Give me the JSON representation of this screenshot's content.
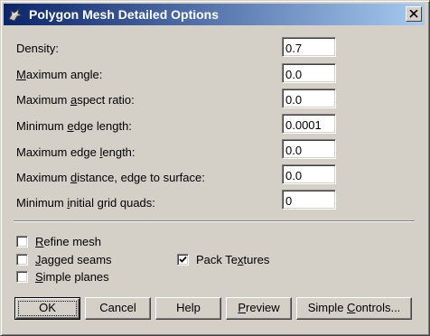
{
  "window": {
    "title": "Polygon Mesh Detailed Options"
  },
  "fields": [
    {
      "pre": "Density:",
      "u": "",
      "post": "",
      "value": "0.7"
    },
    {
      "pre": "",
      "u": "M",
      "post": "aximum angle:",
      "value": "0.0"
    },
    {
      "pre": "Maximum ",
      "u": "a",
      "post": "spect ratio:",
      "value": "0.0"
    },
    {
      "pre": "Minimum ",
      "u": "e",
      "post": "dge length:",
      "value": "0.0001"
    },
    {
      "pre": "Maximum edge ",
      "u": "l",
      "post": "ength:",
      "value": "0.0"
    },
    {
      "pre": "Maximum ",
      "u": "d",
      "post": "istance, edge to surface:",
      "value": "0.0"
    },
    {
      "pre": "Minimum ",
      "u": "i",
      "post": "nitial grid quads:",
      "value": "0"
    }
  ],
  "checkboxes": {
    "refine": {
      "u": "R",
      "post": "efine mesh",
      "checked": false
    },
    "jagged": {
      "u": "J",
      "post": "agged seams",
      "checked": false
    },
    "simple": {
      "u": "S",
      "post": "imple planes",
      "checked": false
    },
    "pack": {
      "pre": "Pack Te",
      "u": "x",
      "post": "tures",
      "checked": true
    }
  },
  "buttons": {
    "ok": "OK",
    "cancel": "Cancel",
    "help": "Help",
    "preview_u": "P",
    "preview_post": "review",
    "simple_pre": "Simple ",
    "simple_u": "C",
    "simple_post": "ontrols..."
  },
  "icons": {
    "app": "rhino-icon",
    "close": "close-icon",
    "check": "check-icon"
  },
  "colors": {
    "face": "#d4d0c8",
    "title_start": "#0a246a",
    "title_end": "#a6caf0"
  }
}
